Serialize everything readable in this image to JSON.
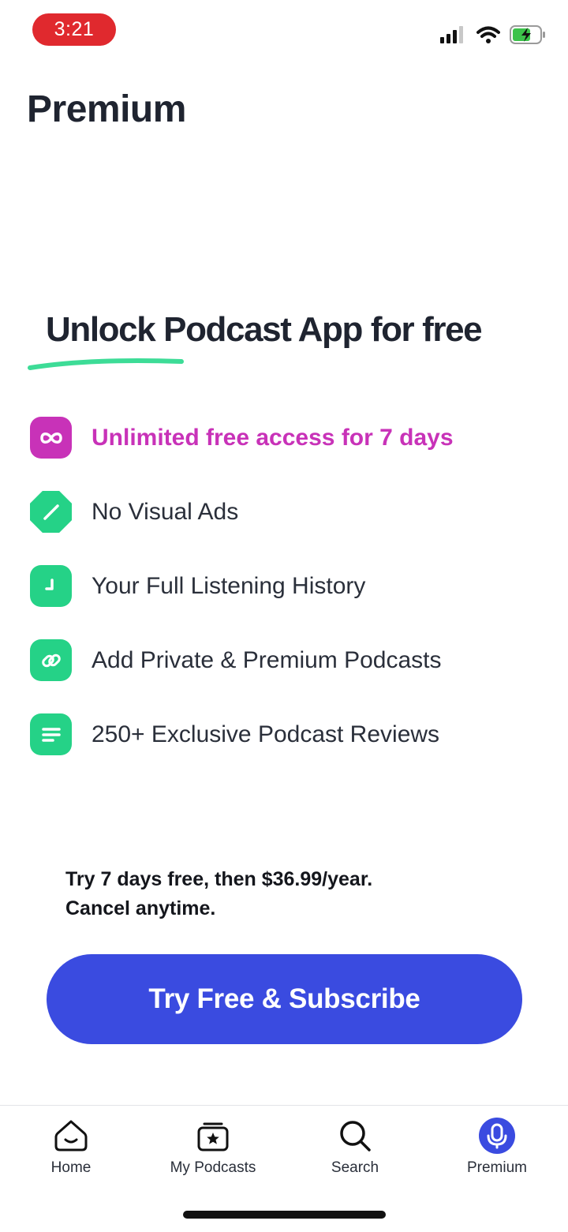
{
  "status_bar": {
    "time": "3:21",
    "time_pill_color": "#e0292e",
    "icons": [
      "signal-icon",
      "wifi-icon",
      "battery-charging-icon"
    ]
  },
  "page": {
    "title": "Premium"
  },
  "headline": {
    "text": "Unlock Podcast App for free",
    "underline_color": "#3ddc97"
  },
  "features": [
    {
      "icon": "infinity-icon",
      "label": "Unlimited free access for 7 days",
      "highlighted": true
    },
    {
      "icon": "no-ads-icon",
      "label": "No Visual Ads",
      "highlighted": false
    },
    {
      "icon": "clock-icon",
      "label": "Your Full Listening History",
      "highlighted": false
    },
    {
      "icon": "link-icon",
      "label": "Add Private & Premium Podcasts",
      "highlighted": false
    },
    {
      "icon": "reviews-icon",
      "label": "250+ Exclusive Podcast Reviews",
      "highlighted": false
    }
  ],
  "pricing": {
    "line1": "Try 7 days free, then $36.99/year.",
    "line2": "Cancel anytime."
  },
  "cta": {
    "label": "Try Free & Subscribe",
    "color": "#3a4be0"
  },
  "tab_bar": {
    "tabs": [
      {
        "label": "Home",
        "icon": "home-icon",
        "active": false
      },
      {
        "label": "My Podcasts",
        "icon": "my-podcasts-icon",
        "active": false
      },
      {
        "label": "Search",
        "icon": "search-icon",
        "active": false
      },
      {
        "label": "Premium",
        "icon": "premium-mic-icon",
        "active": true
      }
    ]
  },
  "colors": {
    "accent_green": "#25d287",
    "highlight_magenta": "#c832b8",
    "primary_blue": "#3a4be0",
    "text_dark": "#1f2430"
  }
}
